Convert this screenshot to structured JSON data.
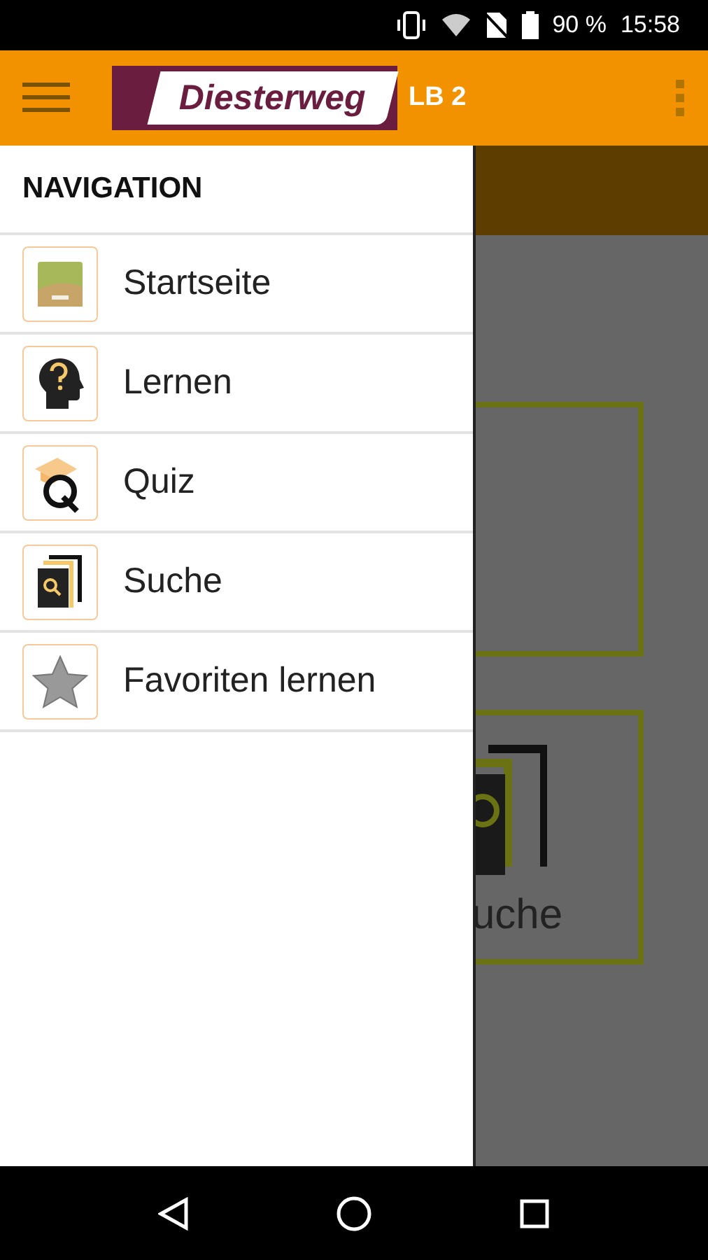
{
  "status_bar": {
    "battery": "90 %",
    "time": "15:58"
  },
  "app_bar": {
    "logo": "Diesterweg",
    "subtitle": "LB 2"
  },
  "drawer": {
    "title": "NAVIGATION",
    "items": [
      {
        "label": "Startseite",
        "kind": "home"
      },
      {
        "label": "Lernen",
        "kind": "learn"
      },
      {
        "label": "Quiz",
        "kind": "quiz"
      },
      {
        "label": "Suche",
        "kind": "search"
      },
      {
        "label": "Favoriten lernen",
        "kind": "favorites"
      }
    ]
  },
  "background": {
    "tiles": [
      {
        "kind": "empty"
      },
      {
        "kind": "search",
        "label": "uche"
      }
    ]
  }
}
